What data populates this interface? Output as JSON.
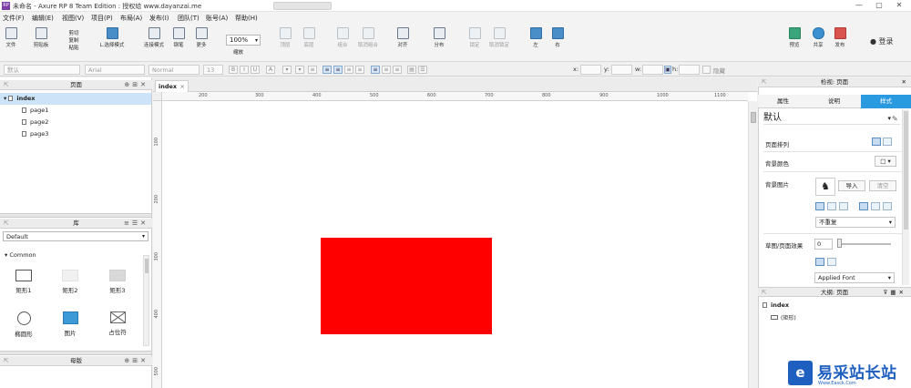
{
  "window": {
    "title": "未命名 - Axure RP 8 Team Edition : 授权给 www.dayanzai.me",
    "minimize": "—",
    "maximize": "▢",
    "close": "✕"
  },
  "menu": [
    "文件(F)",
    "编辑(E)",
    "视图(V)",
    "项目(P)",
    "布局(A)",
    "发布(I)",
    "团队(T)",
    "账号(A)",
    "帮助(H)"
  ],
  "toolbar": {
    "file": "文件",
    "clipboard": "剪贴板",
    "cut": "剪切",
    "copy": "复制",
    "paste_small": "粘贴",
    "select_mode": "L.选择模式",
    "connect_mode": "连接模式",
    "pen": "钢笔",
    "more": "更多",
    "zoom_value": "100%",
    "zoom_label": "缩放",
    "top": "顶层",
    "bottom": "底层",
    "group": "组合",
    "ungroup": "取消组合",
    "align": "对齐",
    "distribute": "分布",
    "lock": "锁定",
    "unlock": "取消锁定",
    "left": "左",
    "right": "右",
    "preview": "预览",
    "share": "共享",
    "publish": "发布",
    "login": "登录",
    "user_icon": "user-icon"
  },
  "format_bar": {
    "style": "默认",
    "font": "Arial",
    "weight": "Normal",
    "size": "13",
    "x_label": "x:",
    "y_label": "y:",
    "w_label": "w:",
    "h_label": "h:",
    "hidden_label": "隐藏"
  },
  "pages_panel": {
    "title": "页面",
    "items": [
      {
        "label": "index",
        "level": 0,
        "selected": true
      },
      {
        "label": "page1",
        "level": 1
      },
      {
        "label": "page2",
        "level": 1
      },
      {
        "label": "page3",
        "level": 1
      }
    ]
  },
  "library_panel": {
    "title": "库",
    "selected_library": "Default",
    "section": "Common",
    "widgets": [
      "矩形1",
      "矩形2",
      "矩形3",
      "椭圆形",
      "图片",
      "占位符"
    ]
  },
  "masters_panel": {
    "title": "母版"
  },
  "canvas": {
    "tab": "index",
    "tab_close": "×",
    "hruler_labels": [
      "200",
      "300",
      "400",
      "500",
      "600",
      "700",
      "800",
      "900",
      "1000",
      "1100"
    ],
    "vruler_labels": [
      "100",
      "200",
      "300",
      "400",
      "500"
    ],
    "shape_color": "#fe0000"
  },
  "inspector": {
    "title": "检视: 页面",
    "tabs": [
      "属性",
      "说明",
      "样式"
    ],
    "active_tab": "样式",
    "style_value": "默认",
    "page_align_label": "页面排列",
    "bg_color_label": "背景颜色",
    "bg_image_label": "背景图片",
    "import_btn": "导入",
    "clear_btn": "清空",
    "repeat_value": "不重复",
    "sketch_label": "草图/页面效果",
    "sketch_value": "0",
    "font_value": "Applied Font"
  },
  "outline": {
    "title": "大纲: 页面",
    "root": "index",
    "child": "(矩形)"
  },
  "watermark": {
    "logo_char": "e",
    "text": "易采站长站",
    "sub": "Www.Easck.Com"
  }
}
